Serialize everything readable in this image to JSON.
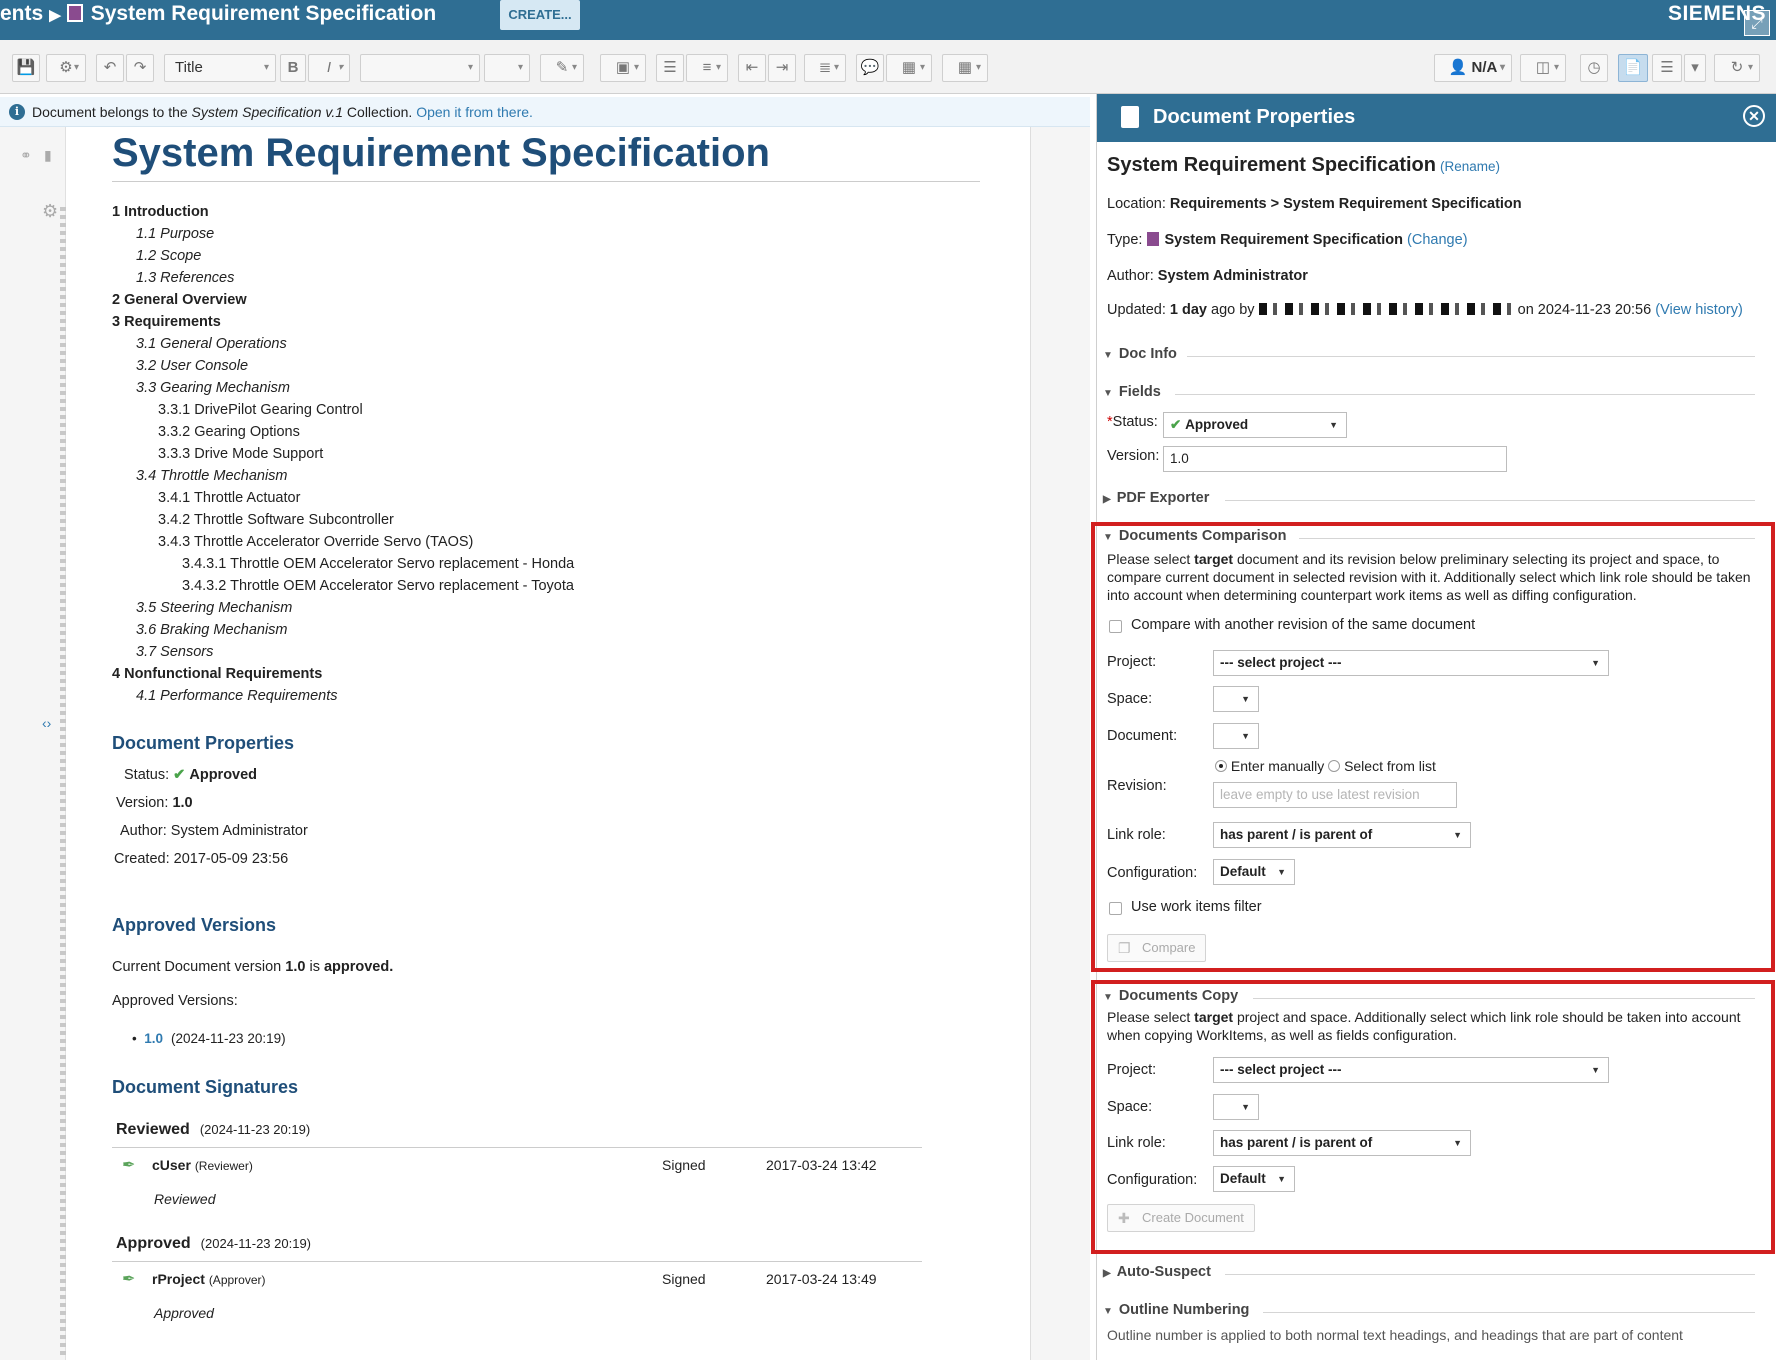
{
  "topbar": {
    "breadcrumb_prev": "ents",
    "doc_title": "System Requirement Specification",
    "create_label": "CREATE...",
    "brand": "SIEMENS"
  },
  "toolbar": {
    "style_select": "Title",
    "user_label": "N/A"
  },
  "infobar": {
    "text_before": "Document belongs to the ",
    "collection": "System Specification v.1",
    "text_after": " Collection. ",
    "link": "Open it from there."
  },
  "document": {
    "title": "System Requirement Specification",
    "toc": [
      {
        "level": 1,
        "text": "1 Introduction"
      },
      {
        "level": 2,
        "text": "1.1 Purpose"
      },
      {
        "level": 2,
        "text": "1.2 Scope"
      },
      {
        "level": 2,
        "text": "1.3 References"
      },
      {
        "level": 1,
        "text": "2 General Overview"
      },
      {
        "level": 1,
        "text": "3 Requirements"
      },
      {
        "level": 2,
        "text": "3.1 General Operations"
      },
      {
        "level": 2,
        "text": "3.2 User Console"
      },
      {
        "level": 2,
        "text": "3.3 Gearing Mechanism"
      },
      {
        "level": 3,
        "text": "3.3.1 DrivePilot Gearing Control"
      },
      {
        "level": 3,
        "text": "3.3.2 Gearing Options"
      },
      {
        "level": 3,
        "text": "3.3.3 Drive Mode Support"
      },
      {
        "level": 2,
        "text": "3.4 Throttle Mechanism"
      },
      {
        "level": 3,
        "text": "3.4.1 Throttle Actuator"
      },
      {
        "level": 3,
        "text": "3.4.2 Throttle Software Subcontroller"
      },
      {
        "level": 3,
        "text": "3.4.3 Throttle Accelerator Override Servo (TAOS)"
      },
      {
        "level": 4,
        "text": "3.4.3.1 Throttle OEM Accelerator Servo replacement - Honda"
      },
      {
        "level": 4,
        "text": "3.4.3.2 Throttle OEM Accelerator Servo replacement - Toyota"
      },
      {
        "level": 2,
        "text": "3.5 Steering Mechanism"
      },
      {
        "level": 2,
        "text": "3.6 Braking Mechanism"
      },
      {
        "level": 2,
        "text": "3.7 Sensors"
      },
      {
        "level": 1,
        "text": "4 Nonfunctional Requirements"
      },
      {
        "level": 2,
        "text": "4.1 Performance Requirements"
      }
    ],
    "props_heading": "Document Properties",
    "status_label": "Status:",
    "status_value": "Approved",
    "version_label": "Version:",
    "version_value": "1.0",
    "author_label": "Author:",
    "author_value": "System Administrator",
    "created_label": "Created:",
    "created_value": "2017-05-09 23:56",
    "approved_heading": "Approved Versions",
    "current_before": "Current Document version ",
    "current_version": "1.0",
    "current_middle": " is ",
    "current_state": "approved.",
    "approved_versions_label": "Approved Versions:",
    "approved_version_item": "1.0",
    "approved_version_date": "(2024-11-23 20:19)",
    "signatures_heading": "Document Signatures",
    "signatures": [
      {
        "group": "Reviewed",
        "group_date": "(2024-11-23 20:19)",
        "user": "cUser",
        "role": "(Reviewer)",
        "state": "Signed",
        "date": "2017-03-24 13:42",
        "note": "Reviewed"
      },
      {
        "group": "Approved",
        "group_date": "(2024-11-23 20:19)",
        "user": "rProject",
        "role": "(Approver)",
        "state": "Signed",
        "date": "2017-03-24 13:49",
        "note": "Approved"
      }
    ]
  },
  "panel": {
    "title": "Document Properties",
    "doc_name": "System Requirement Specification",
    "rename": "Rename",
    "location_label": "Location:",
    "location_root": "Requirements",
    "location_sep": ">",
    "location_doc": "System Requirement Specification",
    "type_label": "Type:",
    "type_value": "System Requirement Specification",
    "change": "Change",
    "author_label": "Author:",
    "author_value": "System Administrator",
    "updated_label": "Updated:",
    "updated_value": "1 day",
    "updated_ago": "ago by",
    "updated_on": "on 2024-11-23 20:56",
    "view_history": "View history",
    "sections": {
      "doc_info": "Doc Info",
      "fields": "Fields",
      "pdf_exporter": "PDF Exporter",
      "documents_comparison": "Documents Comparison",
      "documents_copy": "Documents Copy",
      "auto_suspect": "Auto-Suspect",
      "outline_numbering": "Outline Numbering"
    },
    "fields": {
      "status_label": "Status:",
      "status_value": "Approved",
      "version_label": "Version:",
      "version_value": "1.0"
    },
    "comparison": {
      "desc_1": "Please select ",
      "desc_bold": "target",
      "desc_2": " document and its revision below preliminary selecting its project and space, to compare current document in selected revision with it. Additionally select which link role should be taken into account when determining counterpart work items as well as diffing configuration.",
      "same_doc_checkbox": "Compare with another revision of the same document",
      "project_label": "Project:",
      "project_value": "--- select project ---",
      "space_label": "Space:",
      "document_label": "Document:",
      "revision_label": "Revision:",
      "revision_manual": "Enter manually",
      "revision_list": "Select from list",
      "revision_placeholder": "leave empty to use latest revision",
      "link_role_label": "Link role:",
      "link_role_value": "has parent / is parent of",
      "configuration_label": "Configuration:",
      "configuration_value": "Default",
      "filter_checkbox": "Use work items filter",
      "compare_button": "Compare"
    },
    "copy": {
      "desc_1": "Please select ",
      "desc_bold": "target",
      "desc_2": " project and space. Additionally select which link role should be taken into account when copying WorkItems, as well as fields configuration.",
      "project_label": "Project:",
      "project_value": "--- select project ---",
      "space_label": "Space:",
      "link_role_label": "Link role:",
      "link_role_value": "has parent / is parent of",
      "configuration_label": "Configuration:",
      "configuration_value": "Default",
      "create_button": "Create Document"
    },
    "outline_text": "Outline number is applied to both normal text headings, and headings that are part of content"
  },
  "colors": {
    "header_blue": "#2f6e93",
    "heading_navy": "#1f4e79",
    "link_blue": "#2f7ab0",
    "highlight_red": "#d21f1f",
    "approved_green": "#4aa34a"
  }
}
